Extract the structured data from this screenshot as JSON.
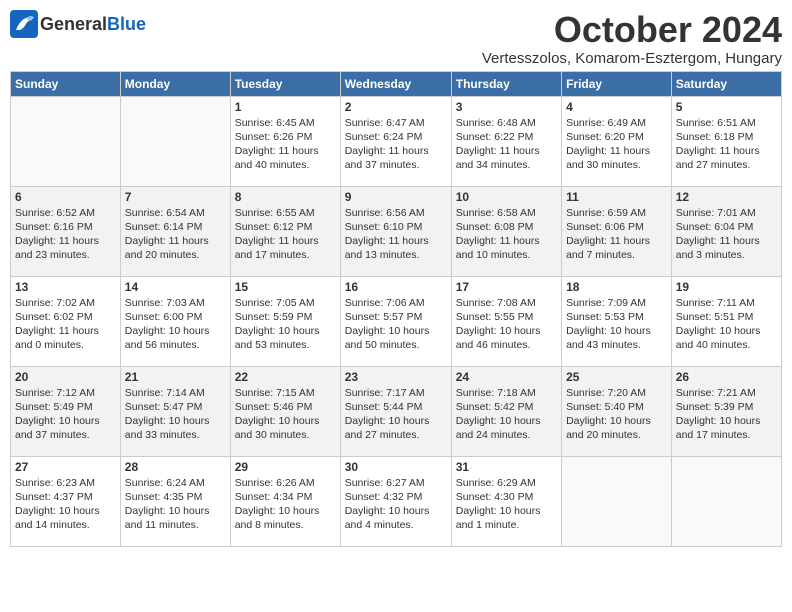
{
  "header": {
    "logo_general": "General",
    "logo_blue": "Blue",
    "month": "October 2024",
    "location": "Vertesszolos, Komarom-Esztergom, Hungary"
  },
  "weekdays": [
    "Sunday",
    "Monday",
    "Tuesday",
    "Wednesday",
    "Thursday",
    "Friday",
    "Saturday"
  ],
  "weeks": [
    [
      {
        "day": "",
        "info": ""
      },
      {
        "day": "",
        "info": ""
      },
      {
        "day": "1",
        "info": "Sunrise: 6:45 AM\nSunset: 6:26 PM\nDaylight: 11 hours and 40 minutes."
      },
      {
        "day": "2",
        "info": "Sunrise: 6:47 AM\nSunset: 6:24 PM\nDaylight: 11 hours and 37 minutes."
      },
      {
        "day": "3",
        "info": "Sunrise: 6:48 AM\nSunset: 6:22 PM\nDaylight: 11 hours and 34 minutes."
      },
      {
        "day": "4",
        "info": "Sunrise: 6:49 AM\nSunset: 6:20 PM\nDaylight: 11 hours and 30 minutes."
      },
      {
        "day": "5",
        "info": "Sunrise: 6:51 AM\nSunset: 6:18 PM\nDaylight: 11 hours and 27 minutes."
      }
    ],
    [
      {
        "day": "6",
        "info": "Sunrise: 6:52 AM\nSunset: 6:16 PM\nDaylight: 11 hours and 23 minutes."
      },
      {
        "day": "7",
        "info": "Sunrise: 6:54 AM\nSunset: 6:14 PM\nDaylight: 11 hours and 20 minutes."
      },
      {
        "day": "8",
        "info": "Sunrise: 6:55 AM\nSunset: 6:12 PM\nDaylight: 11 hours and 17 minutes."
      },
      {
        "day": "9",
        "info": "Sunrise: 6:56 AM\nSunset: 6:10 PM\nDaylight: 11 hours and 13 minutes."
      },
      {
        "day": "10",
        "info": "Sunrise: 6:58 AM\nSunset: 6:08 PM\nDaylight: 11 hours and 10 minutes."
      },
      {
        "day": "11",
        "info": "Sunrise: 6:59 AM\nSunset: 6:06 PM\nDaylight: 11 hours and 7 minutes."
      },
      {
        "day": "12",
        "info": "Sunrise: 7:01 AM\nSunset: 6:04 PM\nDaylight: 11 hours and 3 minutes."
      }
    ],
    [
      {
        "day": "13",
        "info": "Sunrise: 7:02 AM\nSunset: 6:02 PM\nDaylight: 11 hours and 0 minutes."
      },
      {
        "day": "14",
        "info": "Sunrise: 7:03 AM\nSunset: 6:00 PM\nDaylight: 10 hours and 56 minutes."
      },
      {
        "day": "15",
        "info": "Sunrise: 7:05 AM\nSunset: 5:59 PM\nDaylight: 10 hours and 53 minutes."
      },
      {
        "day": "16",
        "info": "Sunrise: 7:06 AM\nSunset: 5:57 PM\nDaylight: 10 hours and 50 minutes."
      },
      {
        "day": "17",
        "info": "Sunrise: 7:08 AM\nSunset: 5:55 PM\nDaylight: 10 hours and 46 minutes."
      },
      {
        "day": "18",
        "info": "Sunrise: 7:09 AM\nSunset: 5:53 PM\nDaylight: 10 hours and 43 minutes."
      },
      {
        "day": "19",
        "info": "Sunrise: 7:11 AM\nSunset: 5:51 PM\nDaylight: 10 hours and 40 minutes."
      }
    ],
    [
      {
        "day": "20",
        "info": "Sunrise: 7:12 AM\nSunset: 5:49 PM\nDaylight: 10 hours and 37 minutes."
      },
      {
        "day": "21",
        "info": "Sunrise: 7:14 AM\nSunset: 5:47 PM\nDaylight: 10 hours and 33 minutes."
      },
      {
        "day": "22",
        "info": "Sunrise: 7:15 AM\nSunset: 5:46 PM\nDaylight: 10 hours and 30 minutes."
      },
      {
        "day": "23",
        "info": "Sunrise: 7:17 AM\nSunset: 5:44 PM\nDaylight: 10 hours and 27 minutes."
      },
      {
        "day": "24",
        "info": "Sunrise: 7:18 AM\nSunset: 5:42 PM\nDaylight: 10 hours and 24 minutes."
      },
      {
        "day": "25",
        "info": "Sunrise: 7:20 AM\nSunset: 5:40 PM\nDaylight: 10 hours and 20 minutes."
      },
      {
        "day": "26",
        "info": "Sunrise: 7:21 AM\nSunset: 5:39 PM\nDaylight: 10 hours and 17 minutes."
      }
    ],
    [
      {
        "day": "27",
        "info": "Sunrise: 6:23 AM\nSunset: 4:37 PM\nDaylight: 10 hours and 14 minutes."
      },
      {
        "day": "28",
        "info": "Sunrise: 6:24 AM\nSunset: 4:35 PM\nDaylight: 10 hours and 11 minutes."
      },
      {
        "day": "29",
        "info": "Sunrise: 6:26 AM\nSunset: 4:34 PM\nDaylight: 10 hours and 8 minutes."
      },
      {
        "day": "30",
        "info": "Sunrise: 6:27 AM\nSunset: 4:32 PM\nDaylight: 10 hours and 4 minutes."
      },
      {
        "day": "31",
        "info": "Sunrise: 6:29 AM\nSunset: 4:30 PM\nDaylight: 10 hours and 1 minute."
      },
      {
        "day": "",
        "info": ""
      },
      {
        "day": "",
        "info": ""
      }
    ]
  ]
}
